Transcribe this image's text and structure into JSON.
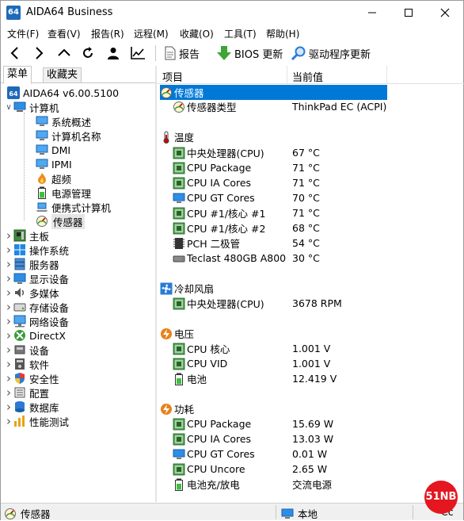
{
  "window": {
    "title": "AIDA64 Business",
    "app_icon_text": "64"
  },
  "menu": [
    "文件(F)",
    "查看(V)",
    "报告(R)",
    "远程(M)",
    "收藏(O)",
    "工具(T)",
    "帮助(H)"
  ],
  "toolbar": {
    "report": "报告",
    "bios_update": "BIOS 更新",
    "driver_update": "驱动程序更新"
  },
  "left_tabs": {
    "menu": "菜单",
    "favorites": "收藏夹"
  },
  "tree": [
    {
      "label": "AIDA64 v6.00.5100",
      "icon": "aida64-icon"
    },
    {
      "label": "计算机",
      "icon": "computer-icon"
    },
    {
      "label": "系统概述",
      "icon": "monitor-icon"
    },
    {
      "label": "计算机名称",
      "icon": "monitor-icon"
    },
    {
      "label": "DMI",
      "icon": "monitor-icon"
    },
    {
      "label": "IPMI",
      "icon": "monitor-icon"
    },
    {
      "label": "超频",
      "icon": "flame-icon"
    },
    {
      "label": "电源管理",
      "icon": "battery-icon"
    },
    {
      "label": "便携式计算机",
      "icon": "laptop-icon"
    },
    {
      "label": "传感器",
      "icon": "gauge-icon"
    },
    {
      "label": "主板",
      "icon": "motherboard-icon"
    },
    {
      "label": "操作系统",
      "icon": "windows-icon"
    },
    {
      "label": "服务器",
      "icon": "server-icon"
    },
    {
      "label": "显示设备",
      "icon": "display-icon"
    },
    {
      "label": "多媒体",
      "icon": "speaker-icon"
    },
    {
      "label": "存储设备",
      "icon": "storage-icon"
    },
    {
      "label": "网络设备",
      "icon": "network-icon"
    },
    {
      "label": "DirectX",
      "icon": "xbox-icon"
    },
    {
      "label": "设备",
      "icon": "devices-icon"
    },
    {
      "label": "软件",
      "icon": "software-icon"
    },
    {
      "label": "安全性",
      "icon": "shield-icon"
    },
    {
      "label": "配置",
      "icon": "config-icon"
    },
    {
      "label": "数据库",
      "icon": "database-icon"
    },
    {
      "label": "性能测试",
      "icon": "benchmark-icon"
    }
  ],
  "columns": {
    "item": "项目",
    "value": "当前值"
  },
  "rows": [
    {
      "name": "传感器",
      "value": "",
      "icon": "gauge-icon"
    },
    {
      "name": "传感器类型",
      "value": "ThinkPad EC  (ACPI)",
      "icon": "gauge-icon"
    },
    {
      "name": "温度",
      "value": "",
      "icon": "thermometer-icon"
    },
    {
      "name": "中央处理器(CPU)",
      "value": "67 °C",
      "icon": "chip-icon"
    },
    {
      "name": "CPU Package",
      "value": "71 °C",
      "icon": "chip-icon"
    },
    {
      "name": "CPU IA Cores",
      "value": "71 °C",
      "icon": "chip-icon"
    },
    {
      "name": "CPU GT Cores",
      "value": "70 °C",
      "icon": "gpu-icon"
    },
    {
      "name": "CPU #1/核心 #1",
      "value": "71 °C",
      "icon": "chip-icon"
    },
    {
      "name": "CPU #1/核心 #2",
      "value": "68 °C",
      "icon": "chip-icon"
    },
    {
      "name": "PCH 二极管",
      "value": "54 °C",
      "icon": "pch-icon"
    },
    {
      "name": "Teclast 480GB A800",
      "value": "30 °C",
      "icon": "disk-icon"
    },
    {
      "name": "冷却风扇",
      "value": "",
      "icon": "fan-icon"
    },
    {
      "name": "中央处理器(CPU)",
      "value": "3678 RPM",
      "icon": "chip-icon"
    },
    {
      "name": "电压",
      "value": "",
      "icon": "voltage-icon"
    },
    {
      "name": "CPU 核心",
      "value": "1.001 V",
      "icon": "chip-icon"
    },
    {
      "name": "CPU VID",
      "value": "1.001 V",
      "icon": "chip-icon"
    },
    {
      "name": "电池",
      "value": "12.419 V",
      "icon": "battery-icon"
    },
    {
      "name": "功耗",
      "value": "",
      "icon": "voltage-icon"
    },
    {
      "name": "CPU Package",
      "value": "15.69 W",
      "icon": "chip-icon"
    },
    {
      "name": "CPU IA Cores",
      "value": "13.03 W",
      "icon": "chip-icon"
    },
    {
      "name": "CPU GT Cores",
      "value": "0.01 W",
      "icon": "gpu-icon"
    },
    {
      "name": "CPU Uncore",
      "value": "2.65 W",
      "icon": "chip-icon"
    },
    {
      "name": "电池充/放电",
      "value": "交流电源",
      "icon": "battery-icon"
    }
  ],
  "status": {
    "left": "传感器",
    "middle": "本地",
    "right": "Cc"
  },
  "watermark": "51NB",
  "colors": {
    "selection": "#0078d7",
    "accent": "#1e6ab8"
  }
}
